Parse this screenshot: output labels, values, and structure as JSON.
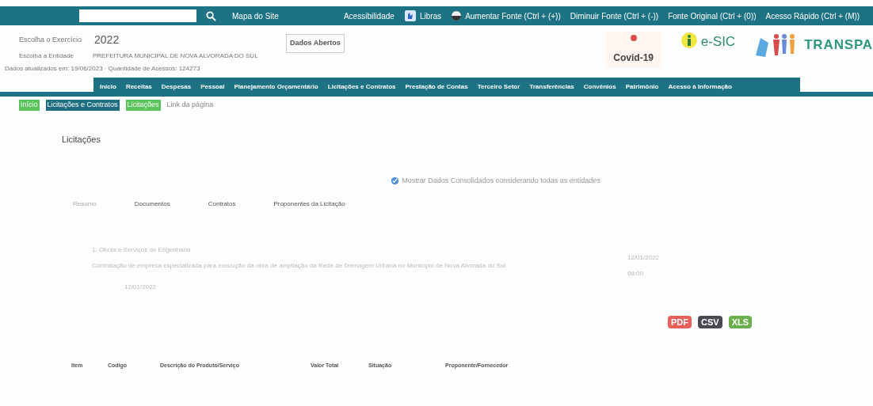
{
  "top_bar": {
    "site_map": "Mapa do Site",
    "links": [
      {
        "label": "Acessibilidade",
        "kind": "plain"
      },
      {
        "label": "Libras",
        "kind": "libras"
      },
      {
        "label": "Aumentar Fonte (Ctrl + (+))",
        "kind": "contrast"
      },
      {
        "label": "Diminuir Fonte (Ctrl + (-))",
        "kind": "plain"
      },
      {
        "label": "Fonte Original (Ctrl + (0))",
        "kind": "plain"
      },
      {
        "label": "Acesso Rápido (Ctrl + (M))",
        "kind": "plain"
      }
    ]
  },
  "header": {
    "year_label": "Escolha o Exercício",
    "year": "2022",
    "entity_label": "Escolha a Entidade",
    "entity": "PREFEITURA MUNICIPAL DE NOVA ALVORADA DO SUL",
    "updated": "Dados atualizados em: 19/06/2023 · Quantidade de Acessos: 124273",
    "open_data": "Dados Abertos",
    "logos": [
      {
        "kind": "covid",
        "label": "Covid-19"
      },
      {
        "kind": "esic",
        "label": "e-SIC"
      },
      {
        "kind": "transparencia",
        "label": "TRANSPA"
      }
    ]
  },
  "nav": [
    "Início",
    "Receitas",
    "Despesas",
    "Pessoal",
    "Planejamento Orçamentário",
    "Licitações e Contratos",
    "Prestação de Contas",
    "Terceiro Setor",
    "Transferências",
    "Convênios",
    "Patrimônio",
    "Acesso à Informação"
  ],
  "breadcrumb": [
    {
      "label": "Início",
      "color": "#5cc45c"
    },
    {
      "label": "Licitações e Contratos",
      "color": "#1f6f80"
    },
    {
      "label": "Licitações",
      "color": "#5cc45c"
    }
  ],
  "page_link": "Link da página",
  "title": "Licitações",
  "consolidated": {
    "label": "Mostrar Dados Consolidados considerando todas as entidades",
    "checked": true
  },
  "tabs": [
    {
      "label": "Resumo",
      "selected": true
    },
    {
      "label": "Documentos",
      "selected": false
    },
    {
      "label": "Contratos",
      "selected": false
    },
    {
      "label": "Proponentes da Licitação",
      "selected": false
    }
  ],
  "details": {
    "category": "1. Obras e Serviços de Engenharia",
    "description": "Contratação de empresa especializada para execução da obra de ampliação da Rede de Drenagem Urbana no Município de Nova Alvorada do Sul",
    "date": "12/01/2022",
    "right": [
      "12/01/2022",
      "08:00"
    ]
  },
  "export": [
    "PDF",
    "CSV",
    "XLS"
  ],
  "table": {
    "columns": [
      "Item",
      "Codigo",
      "Descrição do Produto/Serviço",
      "Valor Total",
      "Situação",
      "Proponente/Fornecedor"
    ]
  }
}
